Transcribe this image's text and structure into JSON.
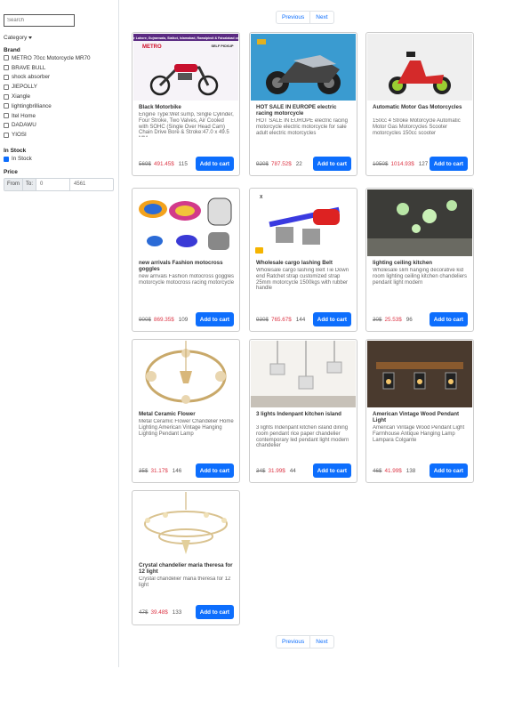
{
  "sidebar": {
    "search_placeholder": "Search",
    "category_label": "Category",
    "brand_title": "Brand",
    "brands": [
      "METRO 70cc Motorcycle  MR70",
      "BRAVE BULL",
      "shock absorber",
      "JIEPOLLY",
      "Xiangle",
      "lightingbrilliance",
      "Itel Home",
      "DADAWU",
      "YIOSI"
    ],
    "stock_title": "In Stock",
    "stock_option": "In Stock",
    "price_title": "Price",
    "price_from_label": "From",
    "price_to_label": "To:",
    "price_min": "0",
    "price_max": "4561"
  },
  "pagination": {
    "previous": "Previous",
    "next": "Next"
  },
  "add_to_cart": "Add to cart",
  "products": [
    {
      "title": "Black Motorbike",
      "desc": "Engine Type:Wet sump, Single Cylinder, Four Stroke, Two Valves, Air Cooled with SOHC (Single Over Head Cam) Chain Drive Bore & Stroke:47.0 x 49.5 MM",
      "old": "569$",
      "new": "491.45$",
      "stock": "115"
    },
    {
      "title": "HOT SALE IN EUROPE electric racing motorcycle",
      "desc": "HOT SALE IN EUROPE electric racing motorcycle electric motorcycle for sale adult electric motorcycles",
      "old": "920$",
      "new": "787.52$",
      "stock": "22"
    },
    {
      "title": "Automatic Motor Gas Motorcycles",
      "desc": "150cc 4 Stroke Motorcycle Automatic Motor Gas Motorcycles Scooter motorcycles 150cc scooter",
      "old": "1050$",
      "new": "1014.93$",
      "stock": "127"
    },
    {
      "title": "new arrivals Fashion motocross goggles",
      "desc": "new arrivals Fashion motocross goggles motorcycle motocross racing motorcycle",
      "old": "900$",
      "new": "869.35$",
      "stock": "109"
    },
    {
      "title": "Wholesale cargo lashing Belt",
      "desc": "Wholesale cargo lashing Belt Tie Down end Ratchet strap customized strap 25mm motorcycle 1500kgs with rubber handle",
      "old": "930$",
      "new": "765.67$",
      "stock": "144"
    },
    {
      "title": "lighting ceiling kitchen",
      "desc": "Wholesale slim hanging decorative kid room lighting ceiling kitchen chandeliers pendant light modern",
      "old": "30$",
      "new": "25.53$",
      "stock": "96"
    },
    {
      "title": "Metal Ceramic Flower",
      "desc": "Metal Ceramic Flower Chandelier Home Lighting American Vintage Hanging Lighting Pendant Lamp",
      "old": "35$",
      "new": "31.17$",
      "stock": "146"
    },
    {
      "title": "3 lights Indenpant kitchen island",
      "desc": "3 lights Indenpant kitchen island dining room pendant rice paper chandelier contemporary led pendant light modern chandelier",
      "old": "34$",
      "new": "31.99$",
      "stock": "44"
    },
    {
      "title": "American Vintage Wood Pendant Light",
      "desc": "American Vintage Wood Pendant Light Farmhouse Antique Hanging Lamp Lampara Colgante",
      "old": "46$",
      "new": "41.99$",
      "stock": "138"
    },
    {
      "title": "Crystal chandelier maria theresa for 12 light",
      "desc": "Crystal chandelier maria theresa for 12 light",
      "old": "47$",
      "new": "39.48$",
      "stock": "133"
    }
  ],
  "banner": {
    "line1": "For Lahore, Gujranwala, Sialkot, Islamabad, Rawalpindi & Faisalabad only",
    "logo": "METRO",
    "pickup": "SELF PICKUP"
  },
  "colors": {
    "accent": "#0d6efd",
    "sale": "#dc3545"
  }
}
